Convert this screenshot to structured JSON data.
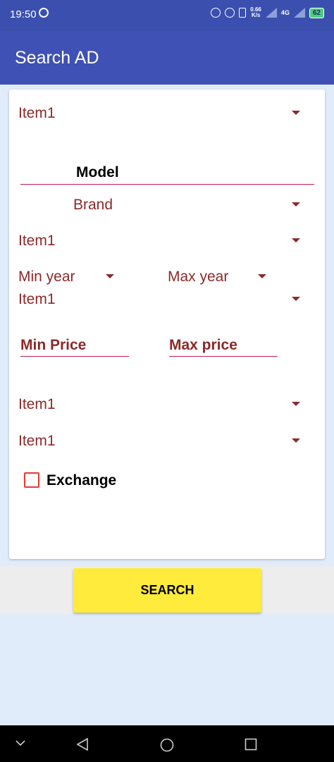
{
  "status_bar": {
    "time": "19:50",
    "network_speed": "0.66",
    "network_unit": "K/s",
    "network_type": "4G",
    "battery": "62"
  },
  "app_bar": {
    "title": "Search AD"
  },
  "form": {
    "spinner_top": "Item1",
    "model_label": "Model",
    "brand_spinner": "Brand",
    "spinner_2": "Item1",
    "min_year": "Min year",
    "max_year": "Max year",
    "spinner_3": "Item1",
    "min_price": "Min Price",
    "max_price": "Max price",
    "spinner_4": "Item1",
    "spinner_5": "Item1",
    "exchange_label": "Exchange"
  },
  "search_button": {
    "label": "SEARCH"
  },
  "colors": {
    "status_bar": "#3a4fae",
    "app_bar": "#3f51b5",
    "spinner_text": "#8b2a2a",
    "underline": "#c2185b",
    "checkbox": "#e53935",
    "button": "#ffeb3b",
    "background": "#e1ecfb"
  }
}
